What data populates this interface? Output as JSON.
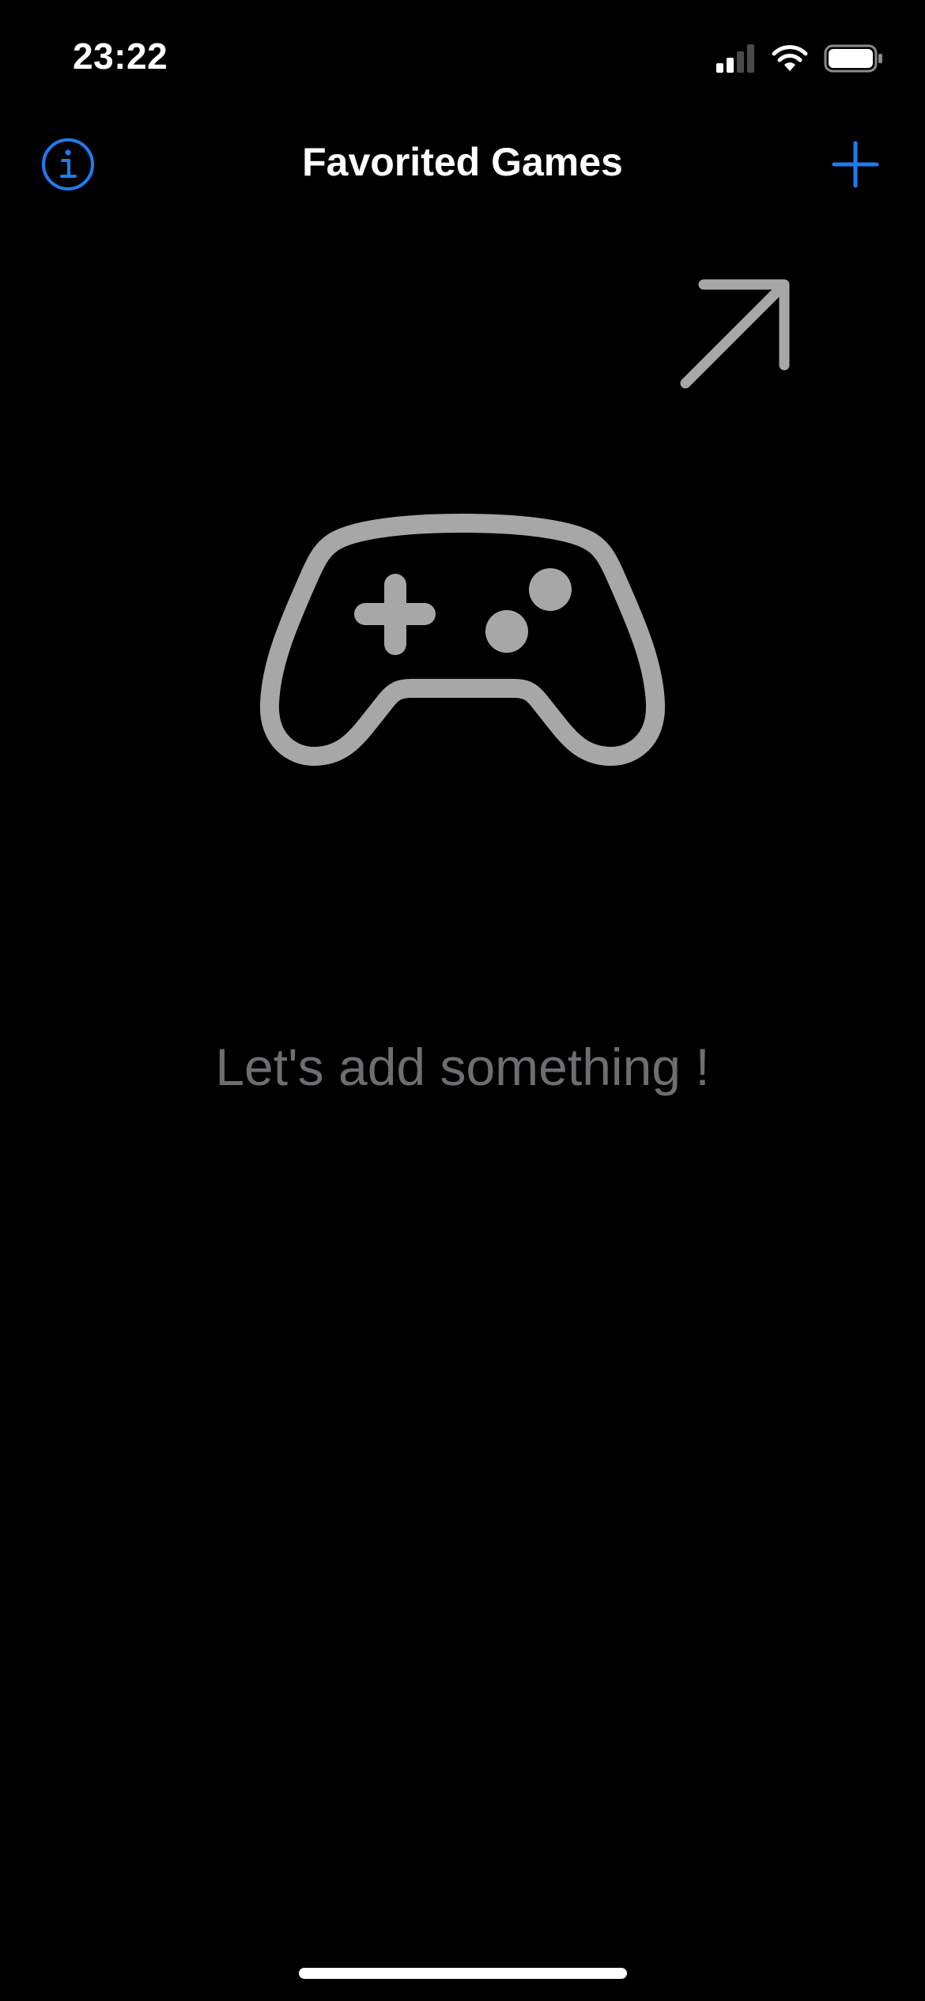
{
  "status_bar": {
    "time": "23:22",
    "icons": [
      "cellular-signal-icon",
      "wifi-icon",
      "battery-icon"
    ]
  },
  "nav": {
    "title": "Favorited Games",
    "left_icon": "info-icon",
    "right_icon": "plus-icon"
  },
  "empty_state": {
    "hint_icon": "arrow-up-right-icon",
    "illustration_icon": "game-controller-icon",
    "message": "Let's add something !"
  },
  "colors": {
    "background": "#000000",
    "accent": "#1E7CF0",
    "illustration": "#A7A7A7",
    "message_text": "#6E6E72",
    "title_text": "#FFFFFF"
  }
}
